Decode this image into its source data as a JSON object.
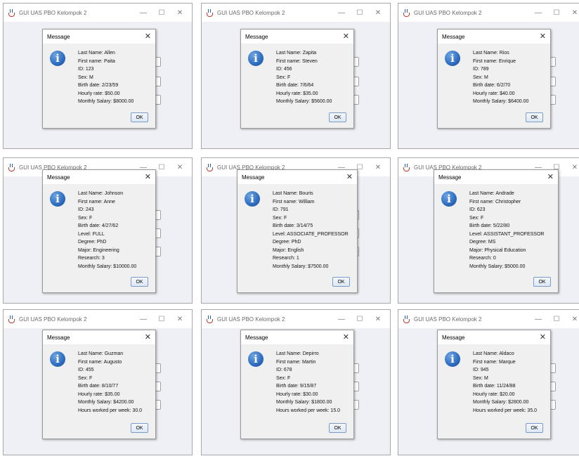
{
  "window_title": "GUI UAS PBO Kelompok 2",
  "dialog_title": "Message",
  "ok_label": "OK",
  "controls": {
    "minimize": "—",
    "maximize": "☐",
    "close": "✕",
    "dialog_close": "✕"
  },
  "icon": "information-icon",
  "info_glyph": "i",
  "colors": {
    "info_icon": "#2d6cc0",
    "window_bg": "#eef0f5",
    "ok_border": "#7a9cc6"
  },
  "dialogs": [
    {
      "lines": [
        "Last Name: Allen",
        "First name: Paita",
        "ID: 123",
        "Sex: M",
        "Birth date: 2/23/59",
        "Hourly rate: $50.00",
        "Monthly Salary: $8000.00"
      ]
    },
    {
      "lines": [
        "Last Name: Zapita",
        "First name: Steven",
        "ID: 456",
        "Sex: F",
        "Birth date: 7/6/64",
        "Hourly rate: $35.00",
        "Monthly Salary: $5600.00"
      ]
    },
    {
      "lines": [
        "Last Name: Rios",
        "First name: Enrique",
        "ID: 789",
        "Sex: M",
        "Birth date: 6/2/70",
        "Hourly rate: $40.00",
        "Monthly Salary: $6400.00"
      ]
    },
    {
      "lines": [
        "Last Name: Johnson",
        "First name: Anne",
        "ID: 243",
        "Sex: F",
        "Birth date: 4/27/62",
        "Level: FULL",
        "Degree: PhD",
        "Major: Engineering",
        "Research: 3",
        "Monthly Salary: $10000.00"
      ]
    },
    {
      "lines": [
        "Last Name: Bouris",
        "First name: William",
        "ID: 791",
        "Sex: F",
        "Birth date: 3/14/75",
        "Level: ASSOCIATE_PROFESSOR",
        "Degree: PhD",
        "Major: English",
        "Research: 1",
        "Monthly Salary: $7500.00"
      ]
    },
    {
      "lines": [
        "Last Name: Andrade",
        "First name: Christopher",
        "ID: 623",
        "Sex: F",
        "Birth date: 5/22/80",
        "Level: ASSISTANT_PROFESSOR",
        "Degree: MS",
        "Major: Physical Education",
        "Research: 0",
        "Monthly Salary: $5000.00"
      ]
    },
    {
      "lines": [
        "Last Name: Guzman",
        "First name: Augusto",
        "ID: 455",
        "Sex: F",
        "Birth date: 8/10/77",
        "Hourly rate: $35.00",
        "Monthly Salary: $4200.00",
        "Hours worked per week: 30.0"
      ]
    },
    {
      "lines": [
        "Last Name: Depirro",
        "First name: Martin",
        "ID: 678",
        "Sex: F",
        "Birth date: 9/15/87",
        "Hourly rate: $30.00",
        "Monthly Salary: $1800.00",
        "Hours worked per week: 15.0"
      ]
    },
    {
      "lines": [
        "Last Name: Aldaco",
        "First name: Marque",
        "ID: 945",
        "Sex: M",
        "Birth date: 11/24/88",
        "Hourly rate: $20.00",
        "Monthly Salary: $2800.00",
        "Hours worked per week: 35.0"
      ]
    }
  ]
}
